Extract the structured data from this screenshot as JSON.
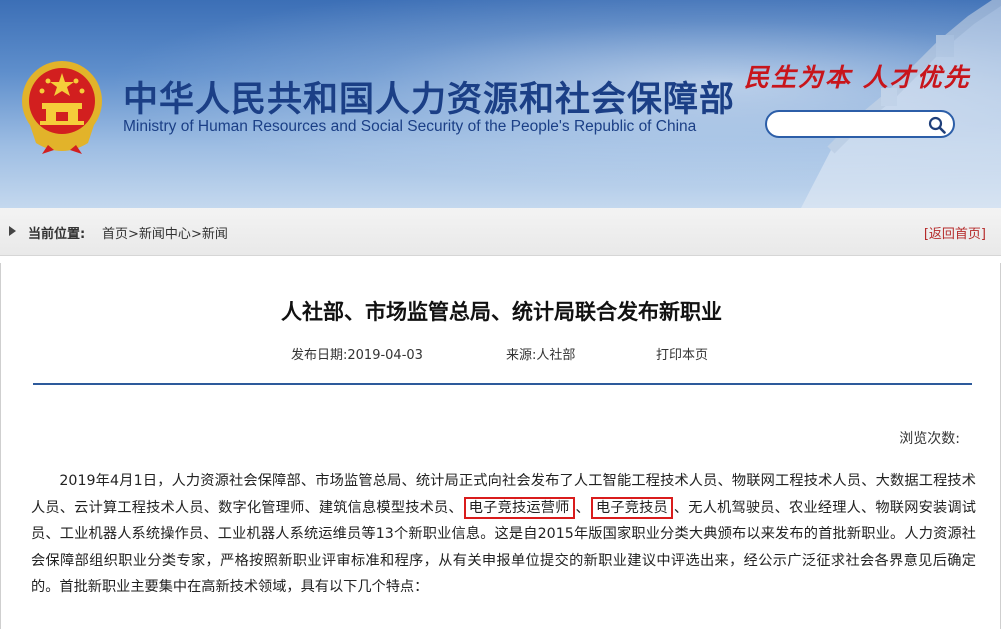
{
  "header": {
    "title_cn": "中华人民共和国人力资源和社会保障部",
    "title_en": "Ministry of Human Resources and Social Security of the People's Republic of China",
    "slogan": "民生为本 人才优先",
    "search": {
      "value": "",
      "placeholder": ""
    },
    "colors": {
      "banner": "#3c6fb6",
      "title": "#1b3f86",
      "slogan": "#c8151b"
    },
    "emblem_icon": "national-emblem-icon"
  },
  "breadcrumb": {
    "label": "当前位置:",
    "items": [
      "首页",
      "新闻中心",
      "新闻"
    ],
    "separator": ">",
    "back_home": "[返回首页]"
  },
  "article": {
    "title": "人社部、市场监管总局、统计局联合发布新职业",
    "date_label": "发布日期:",
    "date": "2019-04-03",
    "source_label": "来源:",
    "source": "人社部",
    "print_label": "打印本页",
    "views_label": "浏览次数:",
    "paragraph": {
      "part1": "2019年4月1日，人力资源社会保障部、市场监管总局、统计局正式向社会发布了人工智能工程技术人员、物联网工程技术人员、大数据工程技术人员、云计算工程技术人员、数字化管理师、建筑信息模型技术员、",
      "highlight1": "电子竞技运营师",
      "sep": "、",
      "highlight2": "电子竞技员",
      "part2": "、无人机驾驶员、农业经理人、物联网安装调试员、工业机器人系统操作员、工业机器人系统运维员等13个新职业信息。这是自2015年版国家职业分类大典颁布以来发布的首批新职业。人力资源社会保障部组织职业分类专家，严格按照新职业评审标准和程序，从有关申报单位提交的新职业建议中评选出来，经公示广泛征求社会各界意见后确定的。首批新职业主要集中在高新技术领域，具有以下几个特点："
    },
    "highlight_color": "#d91c1c"
  }
}
